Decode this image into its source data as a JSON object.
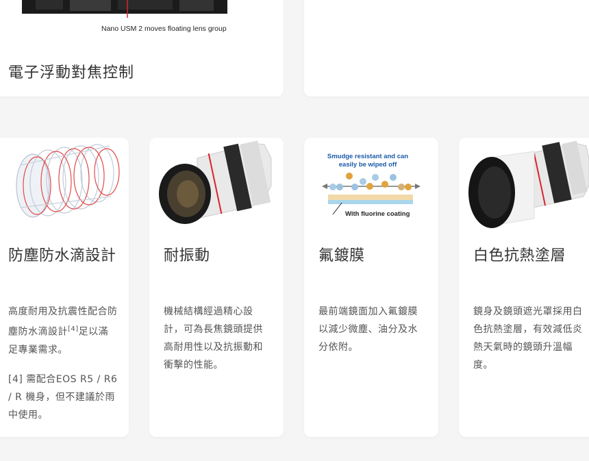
{
  "top_card": {
    "caption": "Nano USM 2 moves floating lens group",
    "title": "電子浮動對焦控制"
  },
  "features": [
    {
      "title": "防塵防水滴設計",
      "body": "高度耐用及抗震性配合防塵防水滴設計",
      "footnote_ref": "[4]",
      "body_after": "足以滿足專業需求。",
      "note": "[4] 需配合EOS R5 / R6 / R 機身，但不建議於雨中使用。"
    },
    {
      "title": "耐振動",
      "body": "機械結構經過精心設計，可為長焦鏡頭提供高耐用性以及抗振動和衝擊的性能。"
    },
    {
      "title": "氟鍍膜",
      "body": "最前端鏡面加入氟鍍膜以減少微塵、油分及水分依附。",
      "diagram": {
        "headline_line1": "Smudge resistant and can",
        "headline_line2": "easily be wiped off",
        "label": "With fluorine coating"
      }
    },
    {
      "title": "白色抗熱塗層",
      "body": "鏡身及鏡頭遮光罩採用白色抗熱塗層，有效減低炎熱天氣時的鏡頭升溫幅度。"
    }
  ],
  "colors": {
    "accent_red": "#d9232d",
    "diagram_blue": "#1a5aa8",
    "page_bg": "#f5f5f5",
    "card_bg": "#ffffff"
  }
}
